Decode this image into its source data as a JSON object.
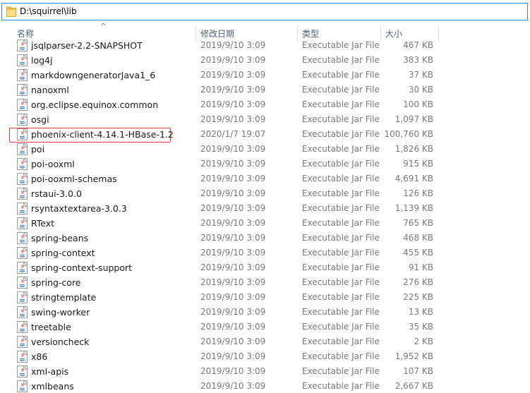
{
  "address": {
    "path": "D:\\squirrel\\lib"
  },
  "columns": {
    "name": "名称",
    "date": "修改日期",
    "type": "类型",
    "size": "大小"
  },
  "files": [
    {
      "name": "jsqlparser-2.2-SNAPSHOT",
      "date": "2019/9/10 3:09",
      "type": "Executable Jar File",
      "size": "467 KB"
    },
    {
      "name": "log4j",
      "date": "2019/9/10 3:09",
      "type": "Executable Jar File",
      "size": "383 KB"
    },
    {
      "name": "markdowngeneratorJava1_6",
      "date": "2019/9/10 3:09",
      "type": "Executable Jar File",
      "size": "37 KB"
    },
    {
      "name": "nanoxml",
      "date": "2019/9/10 3:09",
      "type": "Executable Jar File",
      "size": "30 KB"
    },
    {
      "name": "org.eclipse.equinox.common",
      "date": "2019/9/10 3:09",
      "type": "Executable Jar File",
      "size": "100 KB"
    },
    {
      "name": "osgi",
      "date": "2019/9/10 3:09",
      "type": "Executable Jar File",
      "size": "1,097 KB"
    },
    {
      "name": "phoenix-client-4.14.1-HBase-1.2",
      "date": "2020/1/7 19:07",
      "type": "Executable Jar File",
      "size": "100,760 KB",
      "highlighted": true
    },
    {
      "name": "poi",
      "date": "2019/9/10 3:09",
      "type": "Executable Jar File",
      "size": "1,826 KB"
    },
    {
      "name": "poi-ooxml",
      "date": "2019/9/10 3:09",
      "type": "Executable Jar File",
      "size": "915 KB"
    },
    {
      "name": "poi-ooxml-schemas",
      "date": "2019/9/10 3:09",
      "type": "Executable Jar File",
      "size": "4,691 KB"
    },
    {
      "name": "rstaui-3.0.0",
      "date": "2019/9/10 3:09",
      "type": "Executable Jar File",
      "size": "126 KB"
    },
    {
      "name": "rsyntaxtextarea-3.0.3",
      "date": "2019/9/10 3:09",
      "type": "Executable Jar File",
      "size": "1,139 KB"
    },
    {
      "name": "RText",
      "date": "2019/9/10 3:09",
      "type": "Executable Jar File",
      "size": "765 KB"
    },
    {
      "name": "spring-beans",
      "date": "2019/9/10 3:09",
      "type": "Executable Jar File",
      "size": "468 KB"
    },
    {
      "name": "spring-context",
      "date": "2019/9/10 3:09",
      "type": "Executable Jar File",
      "size": "455 KB"
    },
    {
      "name": "spring-context-support",
      "date": "2019/9/10 3:09",
      "type": "Executable Jar File",
      "size": "91 KB"
    },
    {
      "name": "spring-core",
      "date": "2019/9/10 3:09",
      "type": "Executable Jar File",
      "size": "276 KB"
    },
    {
      "name": "stringtemplate",
      "date": "2019/9/10 3:09",
      "type": "Executable Jar File",
      "size": "225 KB"
    },
    {
      "name": "swing-worker",
      "date": "2019/9/10 3:09",
      "type": "Executable Jar File",
      "size": "13 KB"
    },
    {
      "name": "treetable",
      "date": "2019/9/10 3:09",
      "type": "Executable Jar File",
      "size": "35 KB"
    },
    {
      "name": "versioncheck",
      "date": "2019/9/10 3:09",
      "type": "Executable Jar File",
      "size": "2 KB"
    },
    {
      "name": "x86",
      "date": "2019/9/10 3:09",
      "type": "Executable Jar File",
      "size": "1,952 KB"
    },
    {
      "name": "xml-apis",
      "date": "2019/9/10 3:09",
      "type": "Executable Jar File",
      "size": "107 KB"
    },
    {
      "name": "xmlbeans",
      "date": "2019/9/10 3:09",
      "type": "Executable Jar File",
      "size": "2,667 KB"
    }
  ],
  "icons": {
    "folder": "folder-icon",
    "file": "java-jar-icon",
    "sort": "sort-ascending-arrow"
  },
  "colors": {
    "address_border": "#1e90e8",
    "highlight_border": "#e23838",
    "header_text": "#4c607a"
  }
}
